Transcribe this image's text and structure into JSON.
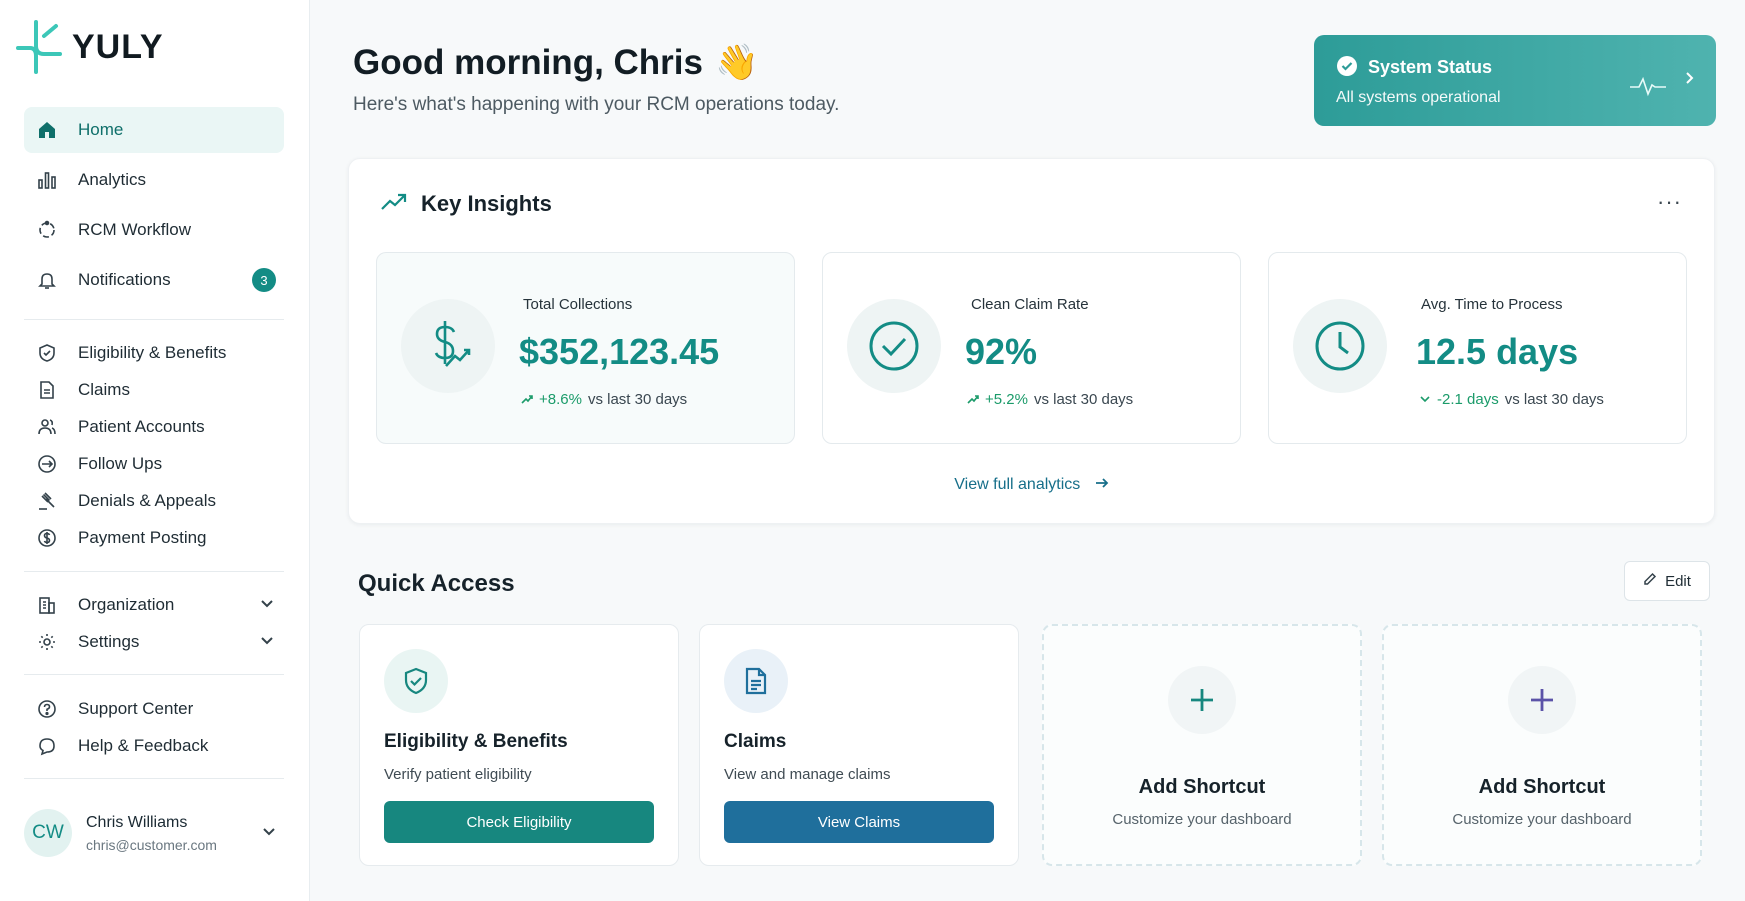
{
  "brand": {
    "name": "YULY",
    "accent": "#138c85"
  },
  "sidebar": {
    "primary": [
      {
        "label": "Home",
        "icon": "home-icon",
        "active": true
      },
      {
        "label": "Analytics",
        "icon": "bar-chart-icon"
      },
      {
        "label": "RCM Workflow",
        "icon": "workflow-cycle-icon"
      },
      {
        "label": "Notifications",
        "icon": "bell-icon",
        "badge": "3"
      }
    ],
    "modules": [
      {
        "label": "Eligibility & Benefits",
        "icon": "shield-check-icon"
      },
      {
        "label": "Claims",
        "icon": "document-icon"
      },
      {
        "label": "Patient Accounts",
        "icon": "users-icon"
      },
      {
        "label": "Follow Ups",
        "icon": "follow-up-arrows-icon"
      },
      {
        "label": "Denials & Appeals",
        "icon": "gavel-icon"
      },
      {
        "label": "Payment Posting",
        "icon": "dollar-circle-icon"
      }
    ],
    "admin": [
      {
        "label": "Organization",
        "icon": "building-icon"
      },
      {
        "label": "Settings",
        "icon": "gear-icon"
      }
    ],
    "help": [
      {
        "label": "Support Center",
        "icon": "question-circle-icon"
      },
      {
        "label": "Help & Feedback",
        "icon": "chat-bubble-icon"
      }
    ],
    "user": {
      "initials": "CW",
      "name": "Chris Williams",
      "email": "chris@customer.com"
    }
  },
  "header": {
    "greeting": "Good morning, Chris",
    "greeting_emoji": "👋",
    "subtitle": "Here's what's happening with your RCM operations today."
  },
  "system_status": {
    "title": "System Status",
    "message": "All systems operational"
  },
  "insights": {
    "title": "Key Insights",
    "more": "···",
    "kpis": [
      {
        "label": "Total Collections",
        "value": "$352,123.45",
        "delta": "+8.6%",
        "delta_suffix": "vs last 30 days",
        "trend": "up"
      },
      {
        "label": "Clean Claim Rate",
        "value": "92%",
        "delta": "+5.2%",
        "delta_suffix": "vs last 30 days",
        "trend": "up"
      },
      {
        "label": "Avg. Time to Process",
        "value": "12.5 days",
        "delta": "-2.1 days",
        "delta_suffix": "vs last 30 days",
        "trend": "down"
      }
    ],
    "view_all": "View full analytics"
  },
  "quick_access": {
    "title": "Quick Access",
    "edit": "Edit",
    "cards": [
      {
        "name": "Eligibility & Benefits",
        "desc": "Verify patient eligibility",
        "button": "Check Eligibility",
        "color": "#17877f"
      },
      {
        "name": "Claims",
        "desc": "View and manage claims",
        "button": "View Claims",
        "color": "#1f6f9c"
      }
    ],
    "add": [
      {
        "title": "Add Shortcut",
        "sub": "Customize your dashboard"
      },
      {
        "title": "Add Shortcut",
        "sub": "Customize your dashboard"
      }
    ]
  }
}
